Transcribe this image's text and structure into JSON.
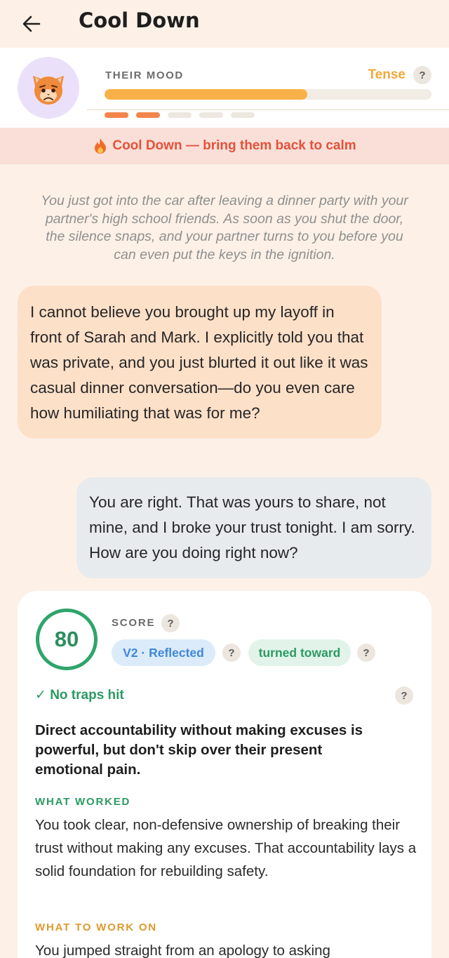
{
  "header": {
    "title": "Cool Down",
    "back_icon": "arrow-left-icon"
  },
  "mood": {
    "label": "THEIR MOOD",
    "value": "Tense",
    "help": "?",
    "level_percent": 62,
    "segments_total": 5,
    "segments_active": 2,
    "avatar_icon": "worried-cat-face-icon",
    "colors": {
      "fill": "#f8b148",
      "value": "#f2a83b",
      "segment_active": "#f4854a"
    }
  },
  "banner": {
    "icon": "fire-icon",
    "text": "Cool Down — bring them back to calm"
  },
  "scenario": "You just got into the car after leaving a dinner party with your partner's high school friends. As soon as you shut the door, the silence snaps, and your partner turns to you before you can even put the keys in the ignition.",
  "messages": {
    "them": "I cannot believe you brought up my layoff in front of Sarah and Mark. I explicitly told you that was private, and you just blurted it out like it was casual dinner conversation—do you even care how humiliating that was for me?",
    "me": "You are right. That was yours to share, not mine, and I broke your trust tonight. I am sorry. How are you doing right now?"
  },
  "score": {
    "value": "80",
    "label": "SCORE",
    "help": "?",
    "tag_version": "V2 · Reflected",
    "tag_direction": "turned toward",
    "traps": "✓ No traps hit",
    "headline": "Direct accountability without making excuses is powerful, but don't skip over their present emotional pain.",
    "worked_label": "WHAT WORKED",
    "worked_text": "You took clear, non-defensive ownership of breaking their trust without making any excuses. That accountability lays a solid foundation for rebuilding safety.",
    "work_on_label": "WHAT TO WORK ON",
    "work_on_text": "You jumped straight from an apology to asking",
    "colors": {
      "ring": "#2ea56b",
      "worked": "#2c9a62",
      "work_on": "#dd9a2c"
    }
  }
}
